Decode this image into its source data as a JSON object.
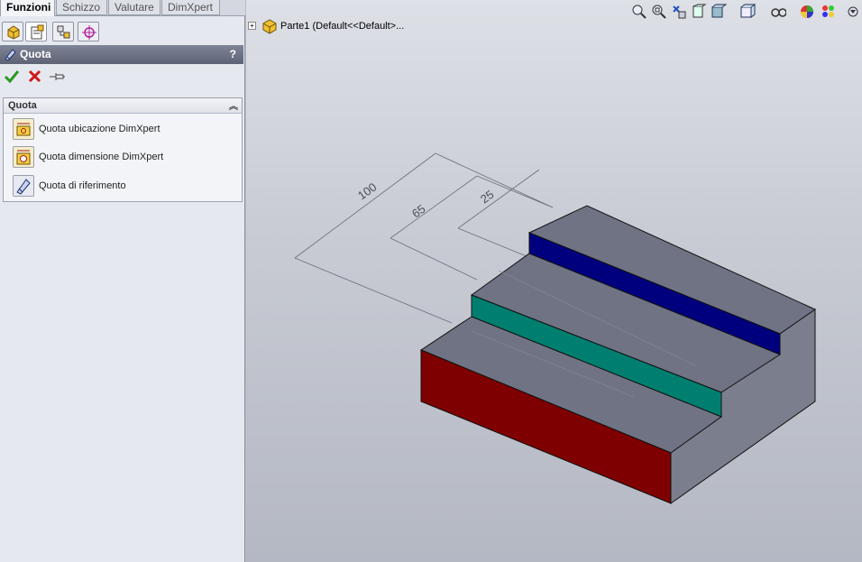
{
  "tabs": [
    {
      "label": "Funzioni",
      "active": true
    },
    {
      "label": "Schizzo",
      "active": false
    },
    {
      "label": "Valutare",
      "active": false
    },
    {
      "label": "DimXpert",
      "active": false
    }
  ],
  "icon_bar": [
    "feature-manager-icon",
    "property-manager-icon",
    "configuration-manager-icon",
    "dimxpert-manager-icon"
  ],
  "property_manager": {
    "title": "Quota",
    "help": "?",
    "actions": [
      "ok-icon",
      "cancel-icon",
      "pushpin-icon"
    ],
    "group": {
      "title": "Quota",
      "items": [
        {
          "label": "Quota ubicazione DimXpert",
          "icon": "location-dimension-icon"
        },
        {
          "label": "Quota dimensione DimXpert",
          "icon": "size-dimension-icon"
        },
        {
          "label": "Quota di riferimento",
          "icon": "reference-dimension-icon"
        }
      ]
    }
  },
  "feature_tree": {
    "label": "Parte1  (Default<<Default>..."
  },
  "view_toolbar": [
    "zoom-to-fit-icon",
    "zoom-to-area-icon",
    "previous-view-icon",
    "section-view-icon",
    "view-orientation-icon",
    "display-style-icon",
    "hide-show-items-icon",
    "edit-appearance-icon",
    "apply-scene-icon"
  ],
  "dimensions": {
    "d1": "100",
    "d2": "65",
    "d3": "25"
  },
  "colors": {
    "top_step_face": "#00007f",
    "middle_step_face": "#007f70",
    "front_face": "#7f0000",
    "body": "#6e7281"
  }
}
